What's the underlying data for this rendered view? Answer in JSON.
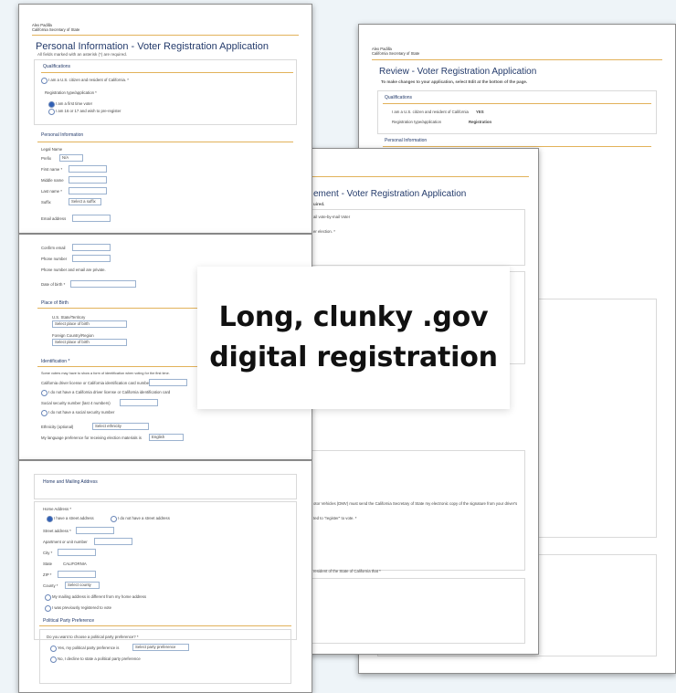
{
  "overlay": {
    "line1": "Long, clunky .gov",
    "line2": "digital registration"
  },
  "page_personal": {
    "agency_line1": "Alex Padilla",
    "agency_line2": "California Secretary of State",
    "title": "Personal Information - Voter Registration Application",
    "subtitle": "All fields marked with an asterisk (*) are required.",
    "section_qualifications": "Qualifications",
    "citizen_label": "I am a U.S. citizen and resident of California. *",
    "reg_type_label": "Registration type/application *",
    "option_new": "I am a first time voter",
    "option_preregister": "I am 16 or 17 and wish to pre-register",
    "section_personal": "Personal Information",
    "legal_name": "Legal Name",
    "prefix_label": "Prefix",
    "prefix_value": "N/A",
    "first_label": "First name *",
    "middle_label": "Middle name",
    "last_label": "Last name *",
    "suffix_label": "Suffix",
    "suffix_value": "Select a suffix",
    "email_label": "Email address"
  },
  "page_contact": {
    "confirm_email": "Confirm email",
    "phone": "Phone number",
    "notice": "Phone number and email are private.",
    "dob_label": "Date of birth *",
    "birth_section": "Place of Birth",
    "us_state_label": "U.S. State/Territory",
    "us_state_value": "Select place of birth",
    "foreign_label": "Foreign Country/Region",
    "foreign_value": "Select place of birth",
    "id_section": "Identification *",
    "id_text": "Some voters may have to show a form of identification when voting for the first time.",
    "dl_label": "California driver license or California identification card number",
    "no_dl": "I do not have a California driver license or California identification card",
    "ssn_label": "Social security number (last 4 numbers)",
    "no_ssn": "I do not have a social security number",
    "ethnicity_label": "Ethnicity (optional)",
    "ethnicity_value": "Select ethnicity",
    "language_label": "My language preference for receiving election materials is",
    "language_value": "English"
  },
  "page_address": {
    "section_title": "Home and Mailing Address",
    "home_address": "Home Address *",
    "street_option": "I have a street address",
    "no_street_option": "I do not have a street address",
    "street_label": "Street address *",
    "apt_label": "Apartment or unit number",
    "city_label": "City *",
    "state_label": "State",
    "state_value": "CALIFORNIA",
    "zip_label": "ZIP *",
    "county_label": "County *",
    "county_value": "Select county",
    "mailing_diff": "My mailing address is different from my home address",
    "prev_reg": "I was previously registered to vote",
    "party_section": "Political Party Preference",
    "party_question": "Do you want to choose a political party preference? *",
    "party_yes": "Yes, my political party preference is",
    "party_select": "Select party preference",
    "party_no": "No, I decline to state a political party preference"
  },
  "page_review": {
    "agency_line1": "Alex Padilla",
    "agency_line2": "California Secretary of State",
    "title": "Review - Voter Registration Application",
    "subtitle": "To make changes to your application, select Edit at the bottom of the page.",
    "section_qualifications": "Qualifications",
    "citizen_label": "I am a U.S. citizen and resident of California",
    "citizen_value": "YES",
    "reg_type_label": "Registration type/application",
    "reg_type_value": "Registration",
    "section_personal": "Personal Information"
  },
  "page_vote_by_mail": {
    "title": "ement - Voter Registration Application",
    "subtitle": "uired.",
    "section": "ail vote-by-mail Voter",
    "line1": "er election. *",
    "line2": "ends by mail/before and ballot election *",
    "line3": "otor Vehicles (DMV) must send the California Secretary of State my electronic copy of the signature from your driver's",
    "line4": "ted to \"register\" to vote. *",
    "line5": "resident of the State of California that *"
  }
}
